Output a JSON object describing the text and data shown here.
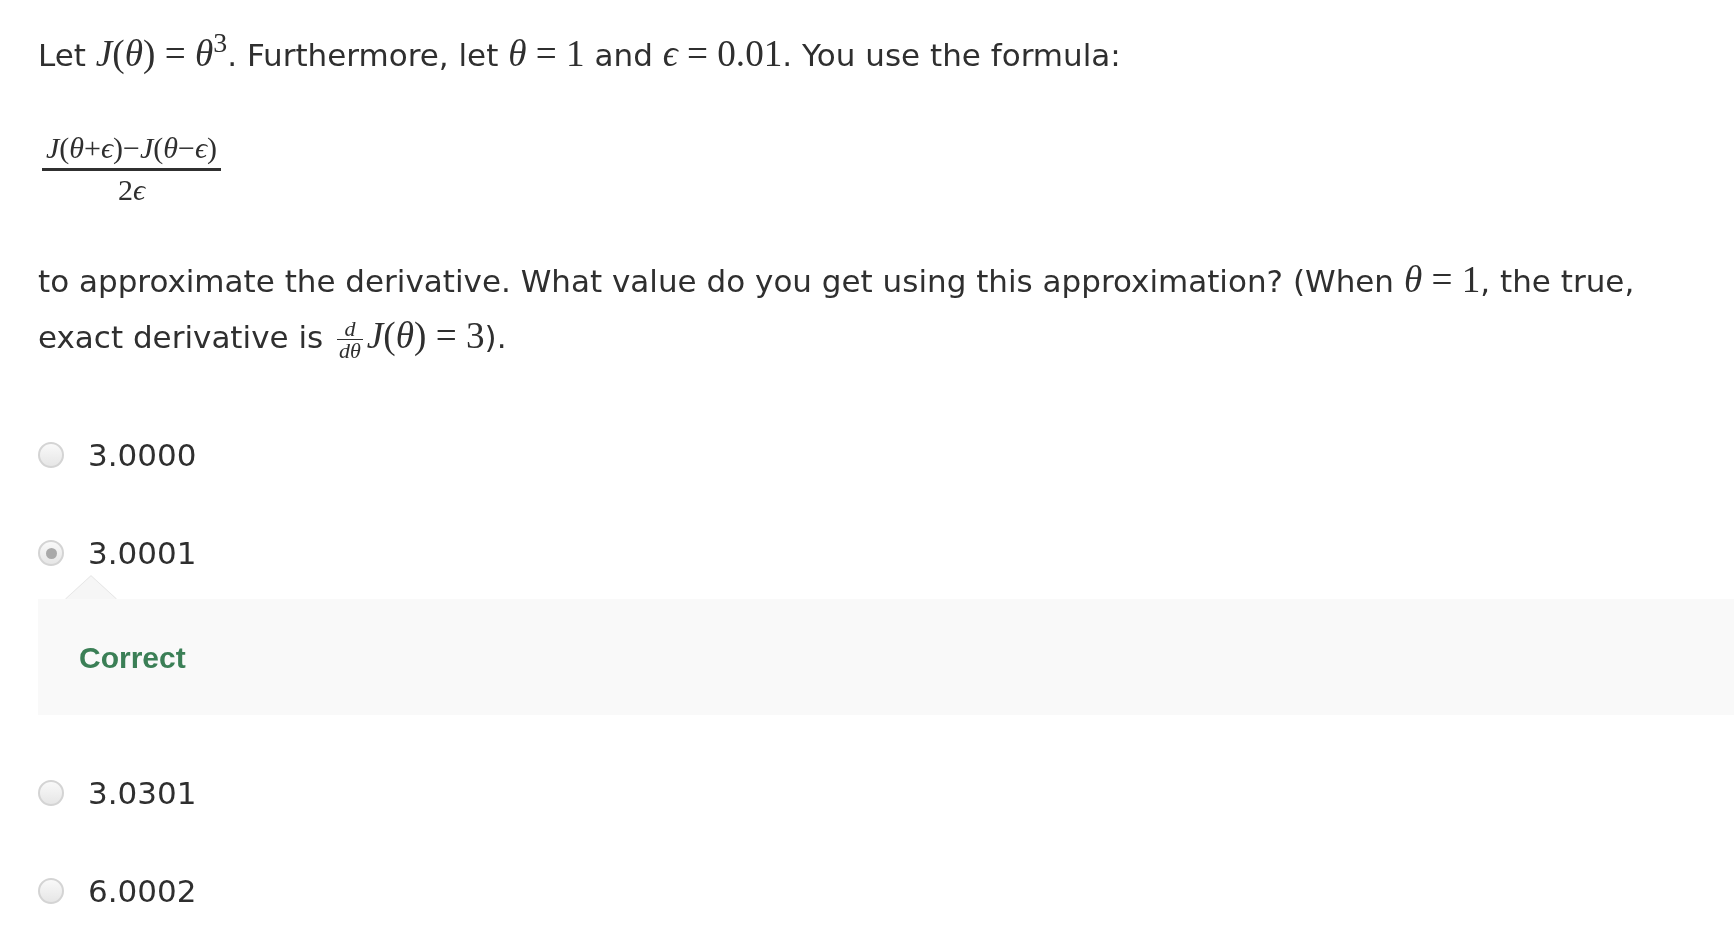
{
  "question": {
    "intro": [
      {
        "kind": "text",
        "text": "Let "
      },
      {
        "kind": "math",
        "text": "*J*(*θ*) = *θ*$^{3}$"
      },
      {
        "kind": "text",
        "text": ". Furthermore, let "
      },
      {
        "kind": "math",
        "text": "*θ* = 1"
      },
      {
        "kind": "text",
        "text": " and "
      },
      {
        "kind": "math",
        "text": "*ϵ* = 0.01"
      },
      {
        "kind": "text",
        "text": ". You use the formula:"
      }
    ],
    "formula": {
      "numerator": [
        {
          "kind": "text",
          "text": "*J*(*θ*+*ϵ*)−*J*(*θ*−*ϵ*)"
        }
      ],
      "denominator": [
        {
          "kind": "text",
          "text": "2"
        },
        {
          "kind": "text",
          "text": "*ϵ*"
        }
      ]
    },
    "prompt": [
      {
        "kind": "text",
        "text": "to approximate the derivative. What value do you get using this approximation? (When "
      },
      {
        "kind": "math",
        "text": "*θ* = 1"
      },
      {
        "kind": "text",
        "text": ", the true, exact derivative is "
      },
      {
        "kind": "fraction",
        "numerator": "*d*",
        "denominator": "*dθ*"
      },
      {
        "kind": "math",
        "text": "*J*(*θ*) = 3"
      },
      {
        "kind": "text",
        "text": ")."
      }
    ]
  },
  "options": [
    {
      "label": "3.0000",
      "selected": false
    },
    {
      "label": "3.0001",
      "selected": true,
      "feedback": {
        "correct": true,
        "label": "Correct"
      }
    },
    {
      "label": "3.0301",
      "selected": false
    },
    {
      "label": "6.0002",
      "selected": false
    }
  ]
}
